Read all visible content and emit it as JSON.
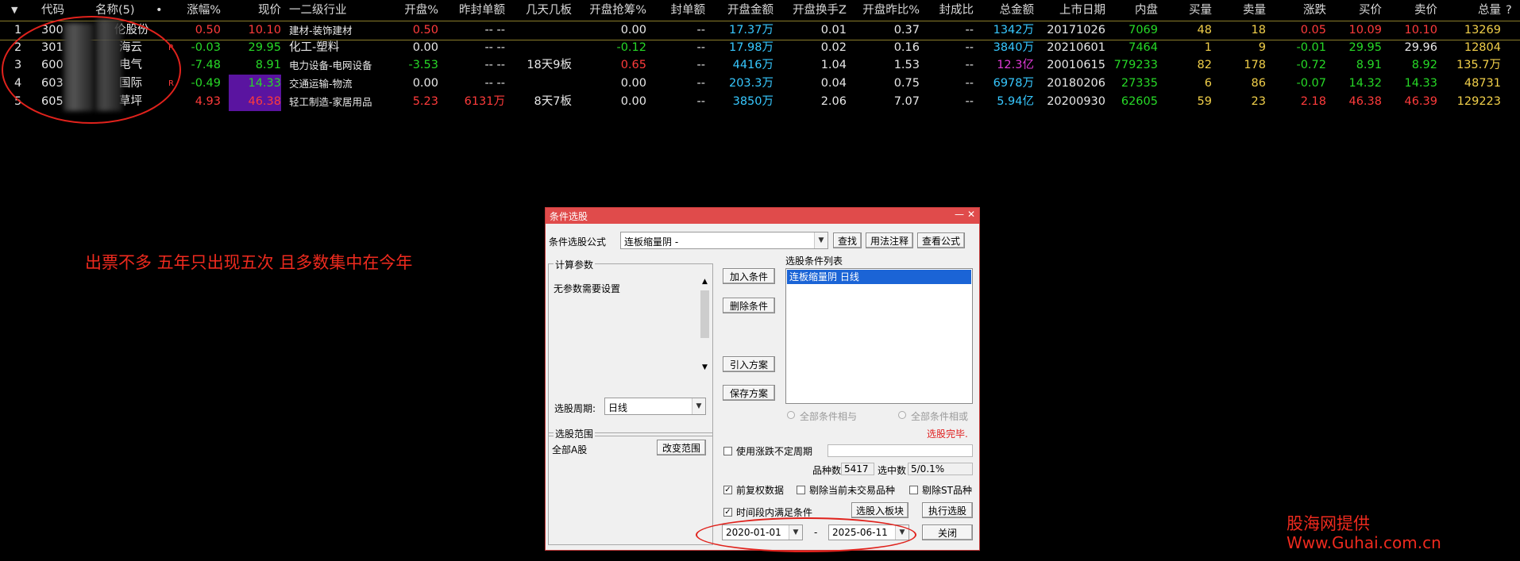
{
  "table": {
    "headers": [
      "代码",
      "名称(5)",
      "•",
      "涨幅%",
      "现价",
      "一二级行业",
      "开盘%",
      "昨封单额",
      "几天几板",
      "开盘抢筹%",
      "封单额",
      "开盘金额",
      "开盘换手Z",
      "开盘昨比%",
      "封成比",
      "总金额",
      "上市日期",
      "内盘",
      "买量",
      "卖量",
      "涨跌",
      "买价",
      "卖价",
      "总量",
      "?"
    ],
    "rows": [
      {
        "no": "1",
        "code": "300",
        "name": "伦股份",
        "flag": "",
        "chg": "0.50",
        "price": "10.10",
        "industry": "建材-装饰建材",
        "open_pct": "0.50",
        "prev_seal": "-- --",
        "boards": "",
        "grab": "0.00",
        "seal": "--",
        "open_amt": "17.37万",
        "turnover": "0.01",
        "open_ratio": "0.37",
        "seal_ratio": "--",
        "total_amt": "1342万",
        "list_date": "20171026",
        "inner": "7069",
        "buy_vol": "48",
        "sell_vol": "18",
        "change": "0.05",
        "bid": "10.09",
        "ask": "10.10",
        "volume": "13269"
      },
      {
        "no": "2",
        "code": "301",
        "name": "海云",
        "flag": "R",
        "chg": "-0.03",
        "price": "29.95",
        "industry": "化工-塑料",
        "open_pct": "0.00",
        "prev_seal": "-- --",
        "boards": "",
        "grab": "-0.12",
        "seal": "--",
        "open_amt": "17.98万",
        "turnover": "0.02",
        "open_ratio": "0.16",
        "seal_ratio": "--",
        "total_amt": "3840万",
        "list_date": "20210601",
        "inner": "7464",
        "buy_vol": "1",
        "sell_vol": "9",
        "change": "-0.01",
        "bid": "29.95",
        "ask": "29.96",
        "volume": "12804"
      },
      {
        "no": "3",
        "code": "600",
        "name": "电气",
        "flag": "",
        "chg": "-7.48",
        "price": "8.91",
        "industry": "电力设备-电网设备",
        "open_pct": "-3.53",
        "prev_seal": "-- --",
        "boards": "18天9板",
        "grab": "0.65",
        "seal": "--",
        "open_amt": "4416万",
        "turnover": "1.04",
        "open_ratio": "1.53",
        "seal_ratio": "--",
        "total_amt": "12.3亿",
        "list_date": "20010615",
        "inner": "779233",
        "buy_vol": "82",
        "sell_vol": "178",
        "change": "-0.72",
        "bid": "8.91",
        "ask": "8.92",
        "volume": "135.7万"
      },
      {
        "no": "4",
        "code": "603",
        "name": "国际",
        "flag": "R",
        "chg": "-0.49",
        "price": "14.33",
        "industry": "交通运输-物流",
        "open_pct": "0.00",
        "prev_seal": "-- --",
        "boards": "",
        "grab": "0.00",
        "seal": "--",
        "open_amt": "203.3万",
        "turnover": "0.04",
        "open_ratio": "0.75",
        "seal_ratio": "--",
        "total_amt": "6978万",
        "list_date": "20180206",
        "inner": "27335",
        "buy_vol": "6",
        "sell_vol": "86",
        "change": "-0.07",
        "bid": "14.32",
        "ask": "14.33",
        "volume": "48731"
      },
      {
        "no": "5",
        "code": "605",
        "name": "草坪",
        "flag": "",
        "chg": "4.93",
        "price": "46.38",
        "industry": "轻工制造-家居用品",
        "open_pct": "5.23",
        "prev_seal": "6131万",
        "boards": "8天7板",
        "grab": "0.00",
        "seal": "--",
        "open_amt": "3850万",
        "turnover": "2.06",
        "open_ratio": "7.07",
        "seal_ratio": "--",
        "total_amt": "5.94亿",
        "list_date": "20200930",
        "inner": "62605",
        "buy_vol": "59",
        "sell_vol": "23",
        "change": "2.18",
        "bid": "46.38",
        "ask": "46.39",
        "volume": "129223"
      }
    ]
  },
  "annotation": {
    "note": "出票不多 五年只出现五次 且多数集中在今年"
  },
  "watermark": {
    "line1": "股海网提供",
    "line2": "Www.Guhai.com.cn"
  },
  "dialog": {
    "title": "条件选股",
    "min_btn": "—",
    "close_btn": "✕",
    "formula_label": "条件选股公式",
    "formula_value": "连板缩量阴  -",
    "find_btn": "查找",
    "usage_btn": "用法注释",
    "view_btn": "查看公式",
    "params_title": "计算参数",
    "params_text": "无参数需要设置",
    "period_label": "选股周期:",
    "period_value": "日线",
    "add_btn": "加入条件",
    "del_btn": "删除条件",
    "import_btn": "引入方案",
    "save_btn": "保存方案",
    "list_title": "选股条件列表",
    "list_item": "连板缩量阴  日线",
    "radio_and": "全部条件相与",
    "radio_or": "全部条件相或",
    "status": "选股完毕.",
    "range_title": "选股范围",
    "range_value": "全部A股",
    "change_range_btn": "改变范围",
    "use_period_label": "使用涨跌不定周期",
    "count_label": "品种数",
    "count_value": "5417",
    "selected_label": "选中数",
    "selected_value": "5/0.1%",
    "pre_adjust": "前复权数据",
    "exclude_untraded": "剔除当前未交易品种",
    "exclude_st": "剔除ST品种",
    "time_range_label": "时间段内满足条件",
    "to_block_btn": "选股入板块",
    "run_btn": "执行选股",
    "date_from": "2020-01-01",
    "date_sep": "-",
    "date_to": "2025-06-11",
    "close_dialog_btn": "关闭"
  },
  "colors": {
    "up": "#ff3b3b",
    "down": "#27d927",
    "highlight": "#5a14a0",
    "dialog_title": "#e04b4b",
    "annotation": "#e0221c"
  }
}
